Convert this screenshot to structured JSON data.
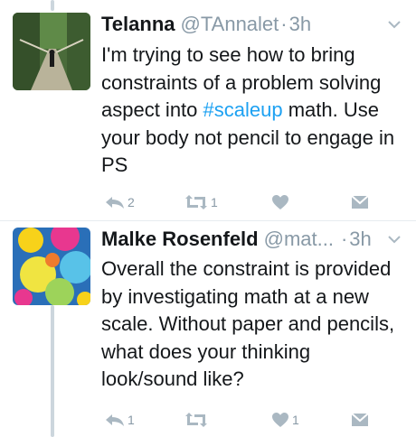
{
  "tweets": [
    {
      "name": "Telanna",
      "handle": "@TAnnalet",
      "dot": "·",
      "time": "3h",
      "text_before": "I'm trying to see how to bring constraints of a problem solving aspect into ",
      "hashtag": "#scaleup",
      "text_after": " math. Use your body not pencil to engage in PS",
      "reply_count": "2",
      "retweet_count": "1",
      "like_count": ""
    },
    {
      "name": "Malke Rosenfeld",
      "handle": "@mat...",
      "dot": "·",
      "time": "3h",
      "text": "Overall the constraint is provided by investigating math at a new scale. Without paper and pencils, what does your thinking look/sound like?",
      "reply_count": "1",
      "retweet_count": "",
      "like_count": "1"
    }
  ],
  "colors": {
    "icon": "#aab8c2",
    "muted": "#8899a6",
    "link": "#1da1f2",
    "thread_line": "#ccd6dd"
  },
  "icons": [
    "reply-icon",
    "retweet-icon",
    "like-icon",
    "dm-icon",
    "chevron-down-icon"
  ]
}
